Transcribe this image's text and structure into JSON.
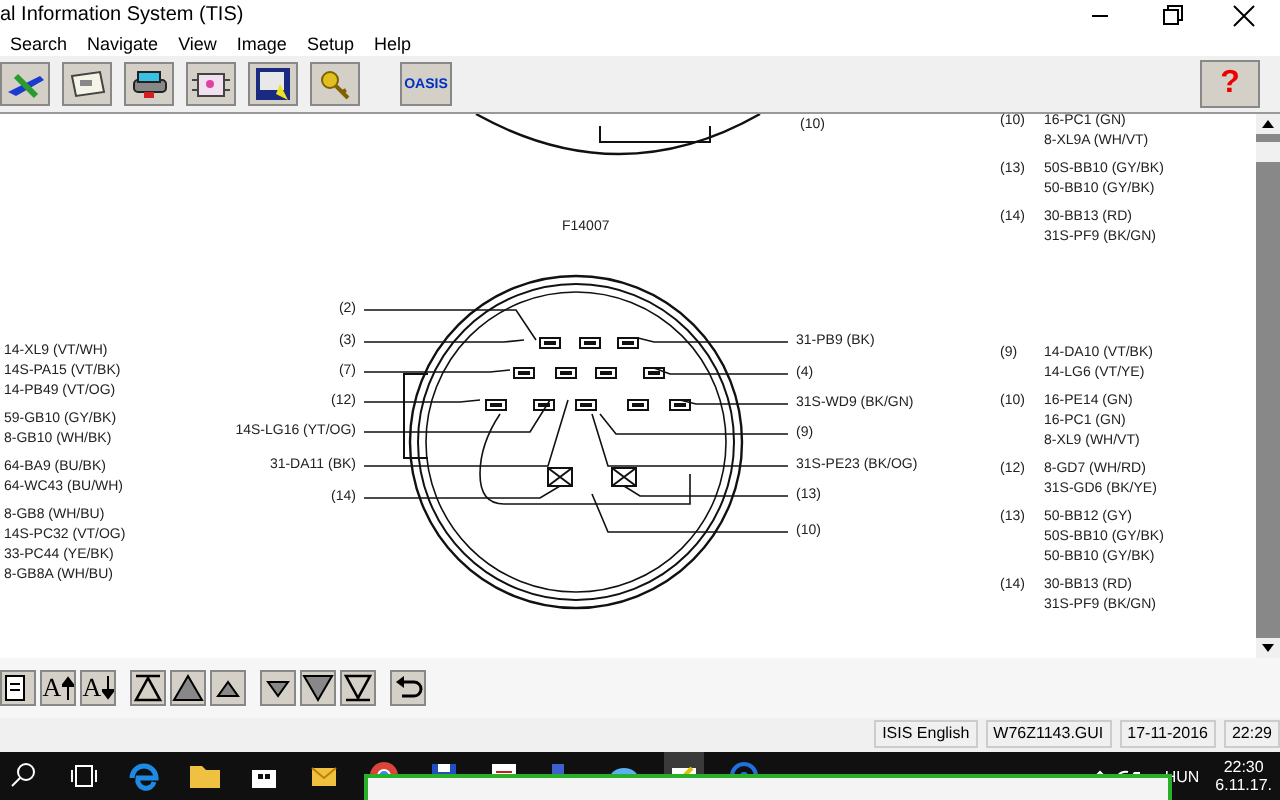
{
  "window": {
    "title": "al Information System (TIS)"
  },
  "menu": [
    "Search",
    "Navigate",
    "View",
    "Image",
    "Setup",
    "Help"
  ],
  "toolbar": [
    {
      "kind": "plane"
    },
    {
      "kind": "card"
    },
    {
      "kind": "car"
    },
    {
      "kind": "chip"
    },
    {
      "kind": "monitor"
    },
    {
      "kind": "key"
    },
    {
      "kind": "oasis",
      "label": "OASIS"
    },
    {
      "kind": "help",
      "label": "?"
    }
  ],
  "diagram": {
    "top_connector_label": "(10)",
    "connector_id": "F14007",
    "left_pins": [
      "(2)",
      "(3)",
      "(7)",
      "(12)",
      "14S-LG16 (YT/OG)",
      "31-DA11 (BK)",
      "(14)"
    ],
    "right_pins": [
      "31-PB9 (BK)",
      "(4)",
      "31S-WD9 (BK/GN)",
      "(9)",
      "31S-PE23 (BK/OG)",
      "(13)",
      "(10)"
    ],
    "left_wires": [
      [
        "14-XL9 (VT/WH)",
        "14S-PA15 (VT/BK)",
        "14-PB49 (VT/OG)"
      ],
      [
        "59-GB10 (GY/BK)",
        "8-GB10 (WH/BK)"
      ],
      [
        "64-BA9 (BU/BK)",
        "64-WC43 (BU/WH)"
      ],
      [
        "8-GB8 (WH/BU)",
        "14S-PC32 (VT/OG)",
        "33-PC44 (YE/BK)",
        "8-GB8A (WH/BU)"
      ]
    ],
    "right_top_wires": [
      {
        "pin": "(10)",
        "wires": [
          "16-PC1 (GN)",
          "8-XL9A (WH/VT)"
        ]
      },
      {
        "pin": "(13)",
        "wires": [
          "50S-BB10 (GY/BK)",
          "50-BB10 (GY/BK)"
        ]
      },
      {
        "pin": "(14)",
        "wires": [
          "30-BB13 (RD)",
          "31S-PF9 (BK/GN)"
        ]
      }
    ],
    "right_wires": [
      {
        "pin": "(9)",
        "wires": [
          "14-DA10 (VT/BK)",
          "14-LG6 (VT/YE)"
        ]
      },
      {
        "pin": "(10)",
        "wires": [
          "16-PE14 (GN)",
          "16-PC1 (GN)",
          "8-XL9 (WH/VT)"
        ]
      },
      {
        "pin": "(12)",
        "wires": [
          "8-GD7 (WH/RD)",
          "31S-GD6 (BK/YE)"
        ]
      },
      {
        "pin": "(13)",
        "wires": [
          "50-BB12 (GY)",
          "50S-BB10 (GY/BK)",
          "50-BB10 (GY/BK)"
        ]
      },
      {
        "pin": "(14)",
        "wires": [
          "30-BB13 (RD)",
          "31S-PF9 (BK/GN)"
        ]
      }
    ]
  },
  "bottom_toolbar": [
    {
      "kind": "page"
    },
    {
      "kind": "font-up",
      "label": "A"
    },
    {
      "kind": "font-down",
      "label": "A"
    },
    {
      "kind": "top"
    },
    {
      "kind": "up-big"
    },
    {
      "kind": "up"
    },
    {
      "kind": "down"
    },
    {
      "kind": "down-big"
    },
    {
      "kind": "bottom"
    },
    {
      "kind": "back"
    }
  ],
  "status_bar": [
    "ISIS English",
    "W76Z1143.GUI",
    "17-11-2016",
    "22:29"
  ],
  "taskbar": {
    "apps": [
      {
        "kind": "search"
      },
      {
        "kind": "tasks"
      },
      {
        "kind": "edge"
      },
      {
        "kind": "folder"
      },
      {
        "kind": "store"
      },
      {
        "kind": "mail"
      },
      {
        "kind": "chrome"
      },
      {
        "kind": "floppy"
      },
      {
        "kind": "doc"
      },
      {
        "kind": "network"
      },
      {
        "kind": "photo"
      },
      {
        "kind": "tis",
        "selected": true
      },
      {
        "kind": "globe"
      }
    ],
    "language": "HUN",
    "time": "22:30",
    "date": "6.11.17."
  }
}
